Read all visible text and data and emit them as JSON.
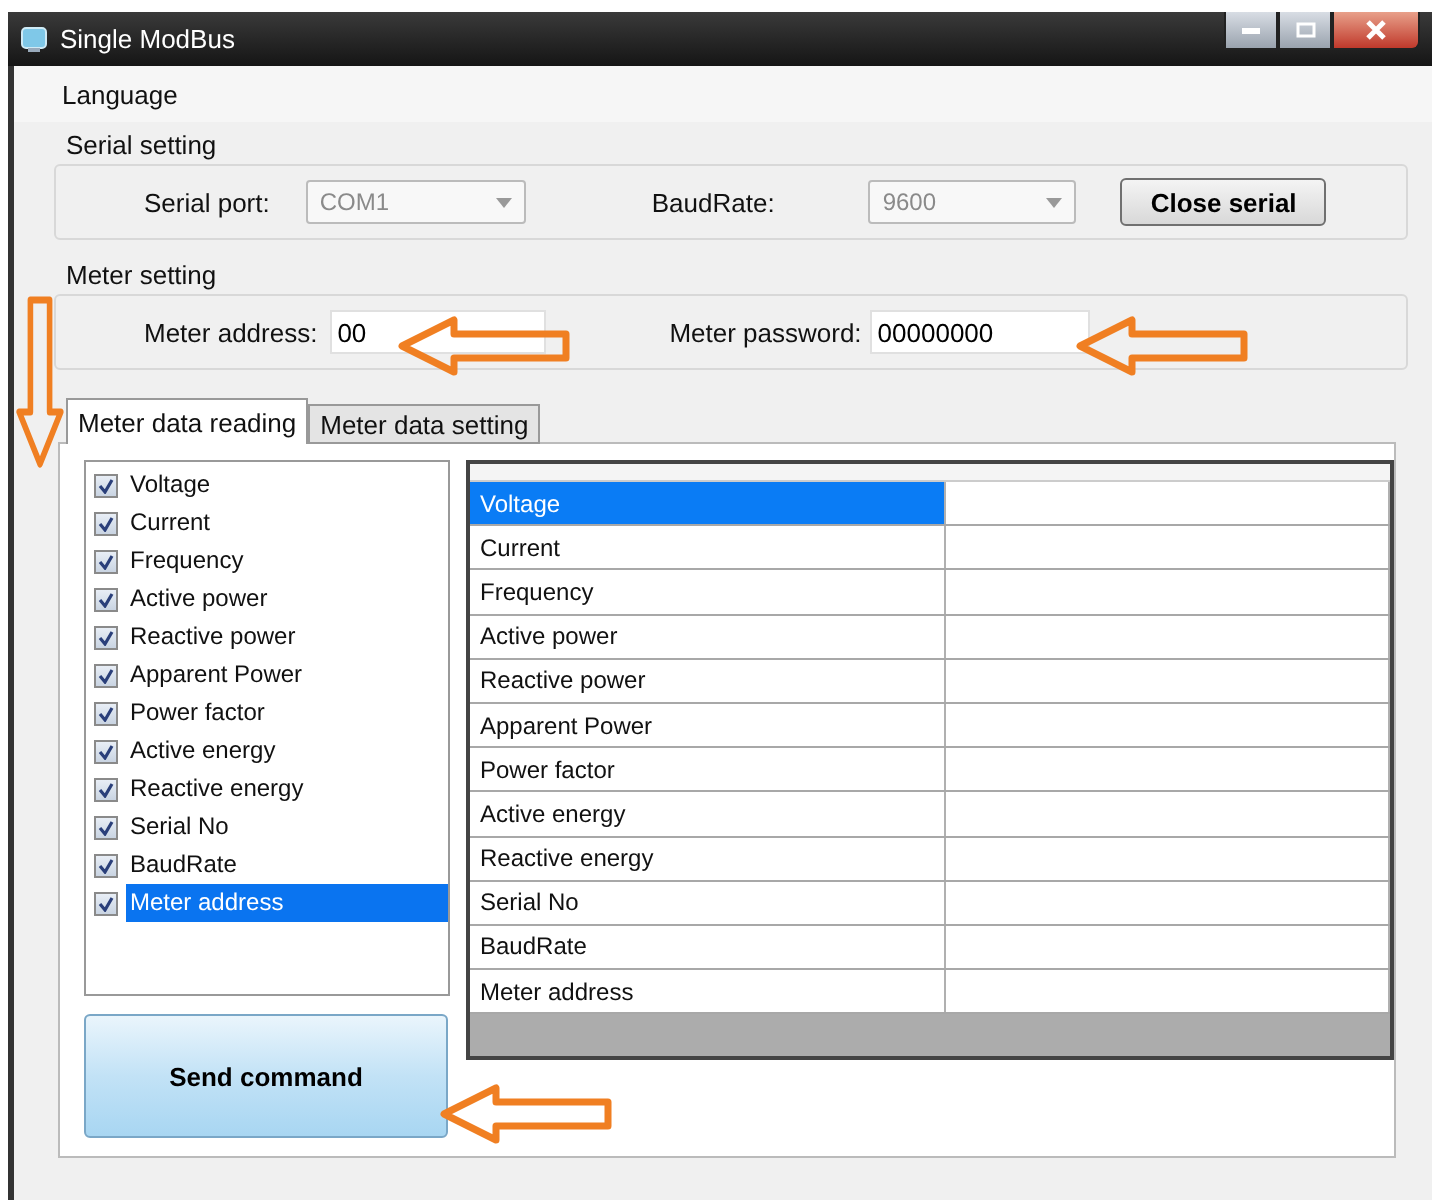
{
  "window": {
    "title": "Single ModBus"
  },
  "menu": [
    "Language"
  ],
  "serial_setting": {
    "title": "Serial setting",
    "port_label": "Serial port:",
    "port": {
      "value": "COM1",
      "disabled": true
    },
    "baud_label": "BaudRate:",
    "baud": {
      "value": "9600",
      "disabled": true
    },
    "button": "Close serial"
  },
  "meter_setting": {
    "title": "Meter setting",
    "address_label": "Meter address:",
    "address": "00",
    "password_label": "Meter password:",
    "password": "00000000"
  },
  "tabs": [
    {
      "label": "Meter data reading",
      "selected": true
    },
    {
      "label": "Meter data setting",
      "selected": false
    }
  ],
  "items": [
    {
      "label": "Voltage",
      "checked": true,
      "selected": false
    },
    {
      "label": "Current",
      "checked": true,
      "selected": false
    },
    {
      "label": "Frequency",
      "checked": true,
      "selected": false
    },
    {
      "label": "Active power",
      "checked": true,
      "selected": false
    },
    {
      "label": "Reactive power",
      "checked": true,
      "selected": false
    },
    {
      "label": "Apparent Power",
      "checked": true,
      "selected": false
    },
    {
      "label": "Power factor",
      "checked": true,
      "selected": false
    },
    {
      "label": "Active energy",
      "checked": true,
      "selected": false
    },
    {
      "label": "Reactive energy",
      "checked": true,
      "selected": false
    },
    {
      "label": "Serial No",
      "checked": true,
      "selected": false
    },
    {
      "label": "BaudRate",
      "checked": true,
      "selected": false
    },
    {
      "label": "Meter address",
      "checked": true,
      "selected": true
    }
  ],
  "table": {
    "rows": [
      {
        "name": "Voltage",
        "selected": true
      },
      {
        "name": "Current",
        "selected": false
      },
      {
        "name": "Frequency",
        "selected": false
      },
      {
        "name": "Active power",
        "selected": false
      },
      {
        "name": "Reactive power",
        "selected": false
      },
      {
        "name": "Apparent Power",
        "selected": false
      },
      {
        "name": "Power factor",
        "selected": false
      },
      {
        "name": "Active energy",
        "selected": false
      },
      {
        "name": "Reactive energy",
        "selected": false
      },
      {
        "name": "Serial No",
        "selected": false
      },
      {
        "name": "BaudRate",
        "selected": false
      },
      {
        "name": "Meter address",
        "selected": false
      }
    ]
  },
  "send_button": "Send command"
}
